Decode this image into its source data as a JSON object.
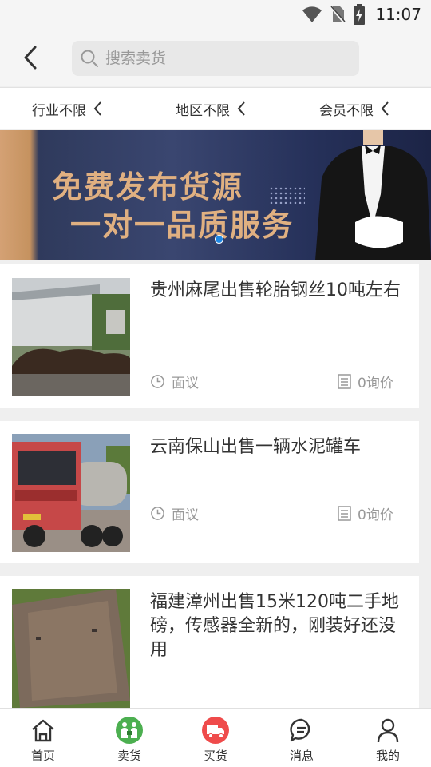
{
  "statusbar": {
    "time": "11:07",
    "icons": [
      "wifi-icon",
      "no-sim-icon",
      "battery-charging-icon"
    ]
  },
  "header": {
    "back_icon": "back-arrow-icon",
    "search_placeholder": "搜索卖货"
  },
  "filters": [
    {
      "label": "行业不限"
    },
    {
      "label": "地区不限"
    },
    {
      "label": "会员不限"
    }
  ],
  "banner": {
    "line1": "免费发布货源",
    "line2": "一对一品质服务",
    "colors": {
      "accent": "#e0b081",
      "background": "#2f3a5c"
    }
  },
  "listings": [
    {
      "title": "贵州麻尾出售轮胎钢丝10吨左右",
      "price": "面议",
      "inquiries": "0询价"
    },
    {
      "title": "云南保山出售一辆水泥罐车",
      "price": "面议",
      "inquiries": "0询价"
    },
    {
      "title": "福建漳州出售15米120吨二手地磅，传感器全新的，刚装好还没用",
      "price": "",
      "inquiries": ""
    }
  ],
  "bottom_nav": [
    {
      "label": "首页",
      "icon": "home-icon"
    },
    {
      "label": "卖货",
      "icon": "sell-icon",
      "color": "#4caf50"
    },
    {
      "label": "买货",
      "icon": "buy-truck-icon",
      "color": "#ef4b4b"
    },
    {
      "label": "消息",
      "icon": "message-icon"
    },
    {
      "label": "我的",
      "icon": "profile-icon"
    }
  ]
}
